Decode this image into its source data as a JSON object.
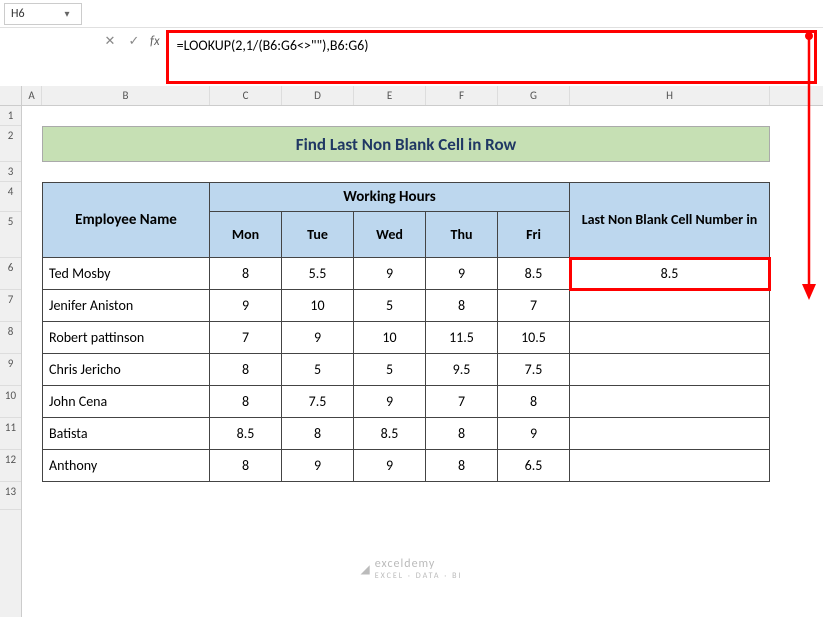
{
  "name_box": "H6",
  "formula": "=LOOKUP(2,1/(B6:G6<>\"\"),B6:G6)",
  "title": "Find Last Non Blank Cell in Row",
  "headers": {
    "employee": "Employee Name",
    "working_hours": "Working Hours",
    "days": [
      "Mon",
      "Tue",
      "Wed",
      "Thu",
      "Fri"
    ],
    "last_non_blank": "Last Non Blank Cell Number in"
  },
  "cols": [
    "A",
    "B",
    "C",
    "D",
    "E",
    "F",
    "G",
    "H"
  ],
  "row_labels": [
    "1",
    "2",
    "3",
    "4",
    "5",
    "6",
    "7",
    "8",
    "9",
    "10",
    "11",
    "12",
    "13"
  ],
  "rows": [
    {
      "name": "Ted Mosby",
      "vals": [
        "8",
        "5.5",
        "9",
        "9",
        "8.5"
      ],
      "res": "8.5"
    },
    {
      "name": "Jenifer Aniston",
      "vals": [
        "9",
        "10",
        "5",
        "8",
        "7"
      ],
      "res": ""
    },
    {
      "name": "Robert pattinson",
      "vals": [
        "7",
        "9",
        "10",
        "11.5",
        "10.5"
      ],
      "res": ""
    },
    {
      "name": "Chris Jericho",
      "vals": [
        "8",
        "5",
        "5",
        "9.5",
        "7.5"
      ],
      "res": ""
    },
    {
      "name": "John Cena",
      "vals": [
        "8",
        "7.5",
        "9",
        "7",
        "8"
      ],
      "res": ""
    },
    {
      "name": "Batista",
      "vals": [
        "8.5",
        "8",
        "8.5",
        "8",
        "9"
      ],
      "res": ""
    },
    {
      "name": "Anthony",
      "vals": [
        "8",
        "9",
        "9",
        "8",
        "6.5"
      ],
      "res": ""
    }
  ],
  "fx": {
    "cancel": "✕",
    "enter": "✓",
    "label": "fx"
  },
  "watermark": {
    "brand": "exceldemy",
    "sub": "EXCEL · DATA · BI"
  },
  "chart_data": {
    "type": "table",
    "title": "Find Last Non Blank Cell in Row",
    "columns": [
      "Employee Name",
      "Mon",
      "Tue",
      "Wed",
      "Thu",
      "Fri",
      "Last Non Blank Cell Number in"
    ],
    "rows": [
      [
        "Ted Mosby",
        8,
        5.5,
        9,
        9,
        8.5,
        8.5
      ],
      [
        "Jenifer Aniston",
        9,
        10,
        5,
        8,
        7,
        null
      ],
      [
        "Robert pattinson",
        7,
        9,
        10,
        11.5,
        10.5,
        null
      ],
      [
        "Chris Jericho",
        8,
        5,
        5,
        9.5,
        7.5,
        null
      ],
      [
        "John Cena",
        8,
        7.5,
        9,
        7,
        8,
        null
      ],
      [
        "Batista",
        8.5,
        8,
        8.5,
        8,
        9,
        null
      ],
      [
        "Anthony",
        8,
        9,
        9,
        8,
        6.5,
        null
      ]
    ]
  }
}
